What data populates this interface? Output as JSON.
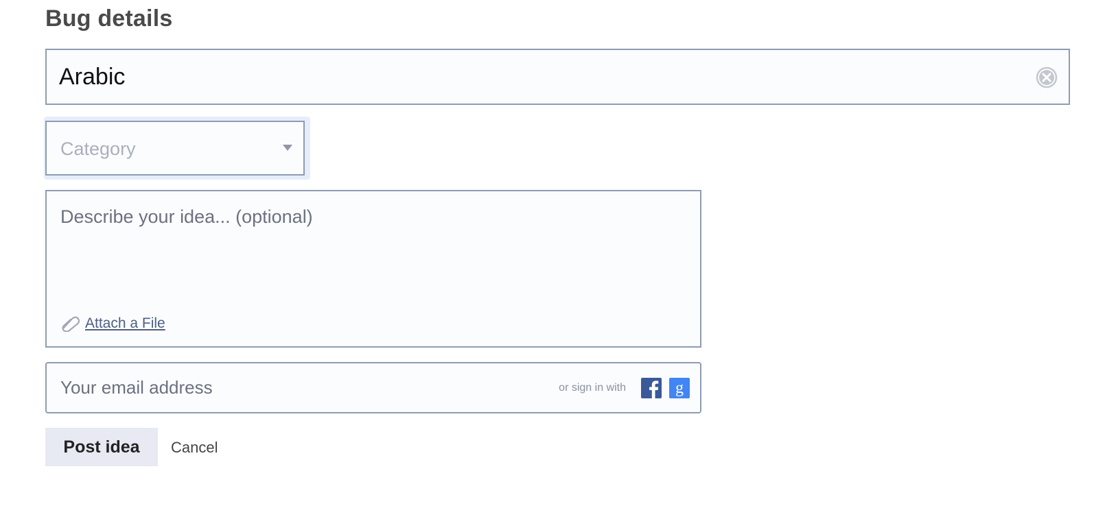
{
  "form": {
    "heading": "Bug details",
    "title_value": "Arabic",
    "category_placeholder": "Category",
    "description_placeholder": "Describe your idea... (optional)",
    "attach_label": "Attach a File",
    "email_placeholder": "Your email address",
    "signin_label": "or sign in with",
    "post_label": "Post idea",
    "cancel_label": "Cancel"
  },
  "icons": {
    "clear": "close-circle-icon",
    "caret": "chevron-down-icon",
    "attach": "paperclip-icon",
    "facebook": "facebook-icon",
    "google": "google-icon"
  },
  "colors": {
    "field_border": "#8e9bb2",
    "field_background": "#fbfcfe",
    "facebook_blue": "#3b5998",
    "google_blue": "#4285f4",
    "post_button_bg": "#e7e9f3"
  }
}
